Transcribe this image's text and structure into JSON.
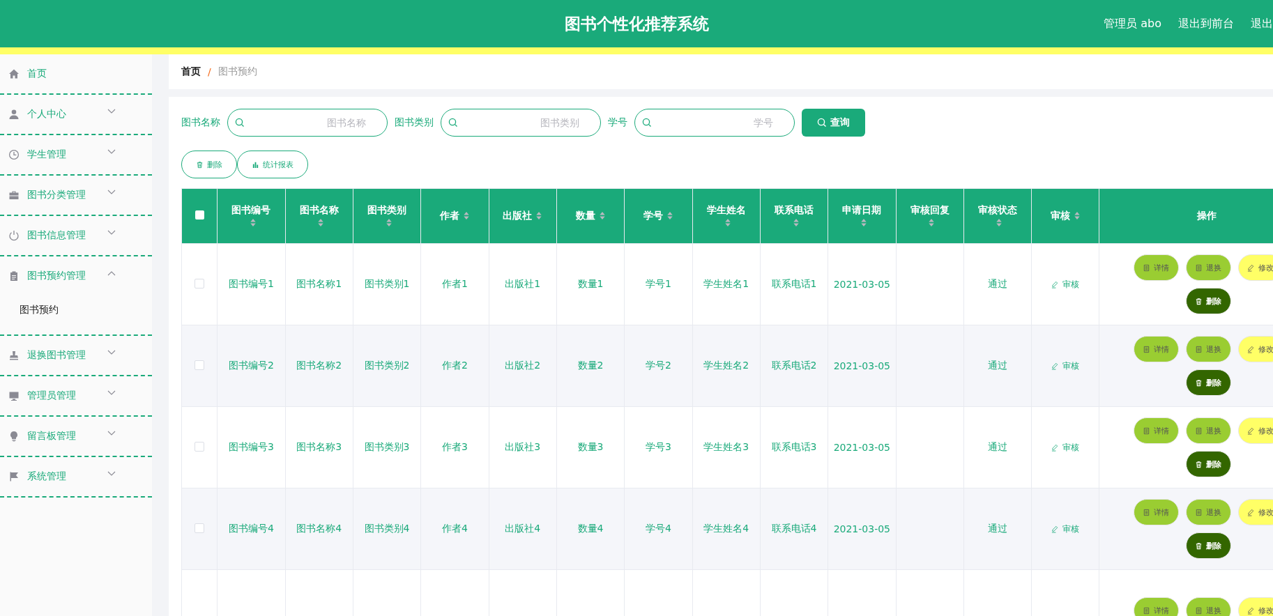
{
  "header": {
    "title": "图书个性化推荐系统",
    "links": [
      "管理员 abo",
      "退出到前台",
      "退出"
    ]
  },
  "sidebar": {
    "items": [
      {
        "label": "首页",
        "expandable": false
      },
      {
        "label": "个人中心",
        "expandable": true,
        "expanded": false
      },
      {
        "label": "学生管理",
        "expandable": true,
        "expanded": false
      },
      {
        "label": "图书分类管理",
        "expandable": true,
        "expanded": false
      },
      {
        "label": "图书信息管理",
        "expandable": true,
        "expanded": false
      },
      {
        "label": "图书预约管理",
        "expandable": true,
        "expanded": true,
        "children": [
          {
            "label": "图书预约"
          }
        ]
      },
      {
        "label": "退换图书管理",
        "expandable": true,
        "expanded": false
      },
      {
        "label": "管理员管理",
        "expandable": true,
        "expanded": false
      },
      {
        "label": "留言板管理",
        "expandable": true,
        "expanded": false
      },
      {
        "label": "系统管理",
        "expandable": true,
        "expanded": false
      }
    ]
  },
  "breadcrumb": [
    "首页",
    "/",
    "图书预约"
  ],
  "search": {
    "fields": [
      {
        "label": "图书名称",
        "placeholder": "图书名称"
      },
      {
        "label": "图书类别",
        "placeholder": "图书类别"
      },
      {
        "label": "学号",
        "placeholder": "学号"
      }
    ],
    "button": "查询"
  },
  "toolbar": [
    {
      "label": "删除",
      "kind": "delete"
    },
    {
      "label": "统计报表",
      "kind": "report"
    }
  ],
  "table": {
    "header_checked": false,
    "columns": [
      {
        "label": "图书编号",
        "sortable": true
      },
      {
        "label": "图书名称",
        "sortable": true
      },
      {
        "label": "图书类别",
        "sortable": true
      },
      {
        "label": "作者",
        "sortable": true
      },
      {
        "label": "出版社",
        "sortable": true
      },
      {
        "label": "数量",
        "sortable": true
      },
      {
        "label": "学号",
        "sortable": true
      },
      {
        "label": "学生姓名",
        "sortable": true
      },
      {
        "label": "联系电话",
        "sortable": true
      },
      {
        "label": "申请日期",
        "sortable": true
      },
      {
        "label": "审核回复",
        "sortable": true
      },
      {
        "label": "审核状态",
        "sortable": true
      },
      {
        "label": "审核",
        "sortable": true
      },
      {
        "label": "操作",
        "sortable": false
      }
    ],
    "rows": [
      {
        "checked": false,
        "cells": [
          "图书编号1",
          "图书名称1",
          "图书类别1",
          "作者1",
          "出版社1",
          "数量1",
          "学号1",
          "学生姓名1",
          "联系电话1",
          "2021-03-05",
          null,
          "通过"
        ],
        "review": "审核",
        "actions": [
          {
            "label": "详情",
            "kind": "detail"
          },
          {
            "label": "退换",
            "kind": "return"
          },
          {
            "label": "修改",
            "kind": "edit"
          },
          {
            "label": "删除",
            "kind": "delete"
          }
        ]
      },
      {
        "checked": false,
        "cells": [
          "图书编号2",
          "图书名称2",
          "图书类别2",
          "作者2",
          "出版社2",
          "数量2",
          "学号2",
          "学生姓名2",
          "联系电话2",
          "2021-03-05",
          null,
          "通过"
        ],
        "review": "审核",
        "actions": [
          {
            "label": "详情",
            "kind": "detail"
          },
          {
            "label": "退换",
            "kind": "return"
          },
          {
            "label": "修改",
            "kind": "edit"
          },
          {
            "label": "删除",
            "kind": "delete"
          }
        ]
      },
      {
        "checked": false,
        "cells": [
          "图书编号3",
          "图书名称3",
          "图书类别3",
          "作者3",
          "出版社3",
          "数量3",
          "学号3",
          "学生姓名3",
          "联系电话3",
          "2021-03-05",
          null,
          "通过"
        ],
        "review": "审核",
        "actions": [
          {
            "label": "详情",
            "kind": "detail"
          },
          {
            "label": "退换",
            "kind": "return"
          },
          {
            "label": "修改",
            "kind": "edit"
          },
          {
            "label": "删除",
            "kind": "delete"
          }
        ]
      },
      {
        "checked": false,
        "cells": [
          "图书编号4",
          "图书名称4",
          "图书类别4",
          "作者4",
          "出版社4",
          "数量4",
          "学号4",
          "学生姓名4",
          "联系电话4",
          "2021-03-05",
          null,
          "通过"
        ],
        "review": "审核",
        "actions": [
          {
            "label": "详情",
            "kind": "detail"
          },
          {
            "label": "退换",
            "kind": "return"
          },
          {
            "label": "修改",
            "kind": "edit"
          },
          {
            "label": "删除",
            "kind": "delete"
          }
        ]
      },
      {
        "actions": [
          {
            "label": "详情",
            "kind": "detail"
          },
          {
            "label": "退换",
            "kind": "return"
          },
          {
            "label": "修改",
            "kind": "edit"
          }
        ]
      }
    ]
  }
}
